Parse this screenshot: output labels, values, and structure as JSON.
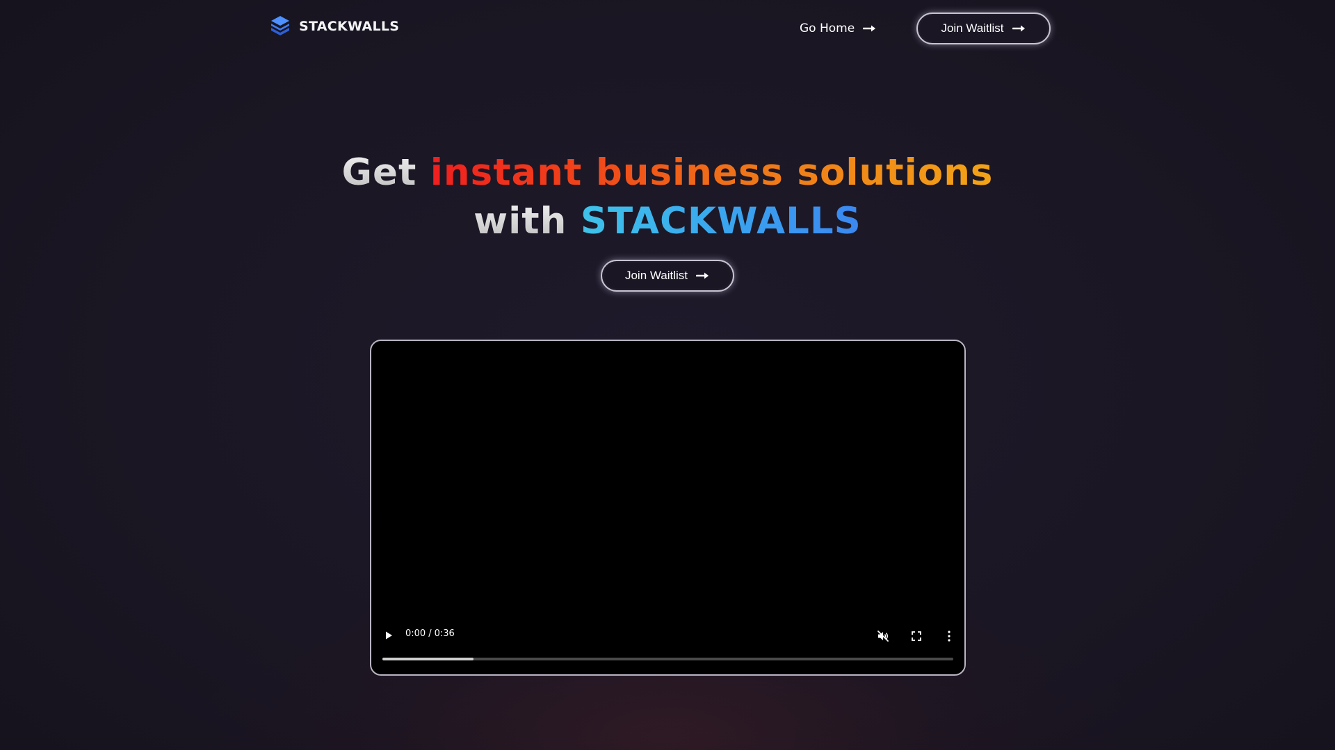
{
  "nav": {
    "brand_name": "STACKWALLS",
    "logo_icon": "stacked-layers-logo-icon",
    "home_link": "Go Home",
    "cta_label": "Join Waitlist",
    "arrow_icon": "arrow-right-icon"
  },
  "hero": {
    "title_part1": "Get",
    "title_highlight": "instant business solutions",
    "title_part2": "with",
    "title_brand": "STACKWALLS",
    "cta_label": "Join Waitlist"
  },
  "video": {
    "current_time": "0:00",
    "separator": "/",
    "duration": "0:36",
    "buffered_fraction": 0.16,
    "icons": {
      "play": "play-icon",
      "mute": "volume-muted-icon",
      "fullscreen": "fullscreen-icon",
      "more": "more-options-icon"
    }
  },
  "colors": {
    "background": "#1c1826",
    "highlight_start": "#ef1f1f",
    "highlight_end": "#f2a417",
    "brand_gradient_start": "#3ec3e9",
    "brand_gradient_end": "#3b87f0",
    "logo_blue": "#3b7bf0"
  }
}
